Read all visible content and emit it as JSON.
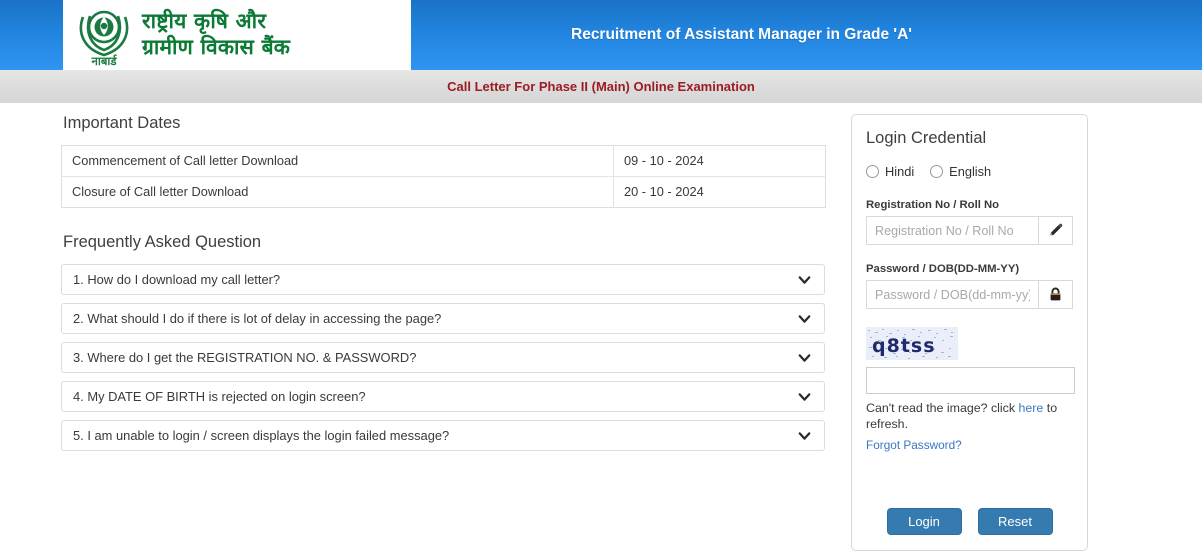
{
  "header": {
    "logo_line1": "राष्ट्रीय कृषि और",
    "logo_line2": "ग्रामीण विकास बैंक",
    "logo_caption": "नाबार्ड",
    "title": "Recruitment of Assistant Manager in Grade 'A'",
    "subtitle": "Call Letter For Phase II (Main) Online Examination",
    "accent_blue": "#2184de",
    "subtitle_color": "#9b1c22",
    "logo_green": "#0a7a34"
  },
  "important_dates": {
    "heading": "Important Dates",
    "rows": [
      {
        "label": "Commencement of Call letter Download",
        "value": "09 - 10 - 2024"
      },
      {
        "label": "Closure of Call letter Download",
        "value": "20 - 10 - 2024"
      }
    ]
  },
  "faq": {
    "heading": "Frequently Asked Question",
    "items": [
      {
        "text": "1. How do I download my call letter?",
        "icon": "chevron-down-icon"
      },
      {
        "text": "2. What should I do if there is lot of delay in accessing the page?",
        "icon": "chevron-down-icon"
      },
      {
        "text": "3. Where do I get the REGISTRATION NO. & PASSWORD?",
        "icon": "chevron-down-icon"
      },
      {
        "text": "4. My DATE OF BIRTH is rejected on login screen?",
        "icon": "chevron-down-icon"
      },
      {
        "text": "5. I am unable to login / screen displays the login failed message?",
        "icon": "chevron-down-icon"
      }
    ]
  },
  "login": {
    "title": "Login Credential",
    "language": {
      "hindi_label": "Hindi",
      "english_label": "English",
      "selected": ""
    },
    "registration": {
      "label": "Registration No / Roll No",
      "placeholder": "Registration No / Roll No",
      "value": "",
      "addon_icon": "pencil-icon"
    },
    "password": {
      "label": "Password / DOB(DD-MM-YY)",
      "placeholder": "Password / DOB(dd-mm-yy)",
      "value": "",
      "addon_icon": "lock-icon"
    },
    "captcha": {
      "image_text": "q8tss",
      "input_value": "",
      "input_placeholder": "",
      "help_prefix": "Can't read the image? click ",
      "help_link": "here",
      "help_suffix": " to refresh."
    },
    "forgot_password": "Forgot Password?",
    "buttons": {
      "login": "Login",
      "reset": "Reset",
      "color": "#357bb0"
    }
  }
}
